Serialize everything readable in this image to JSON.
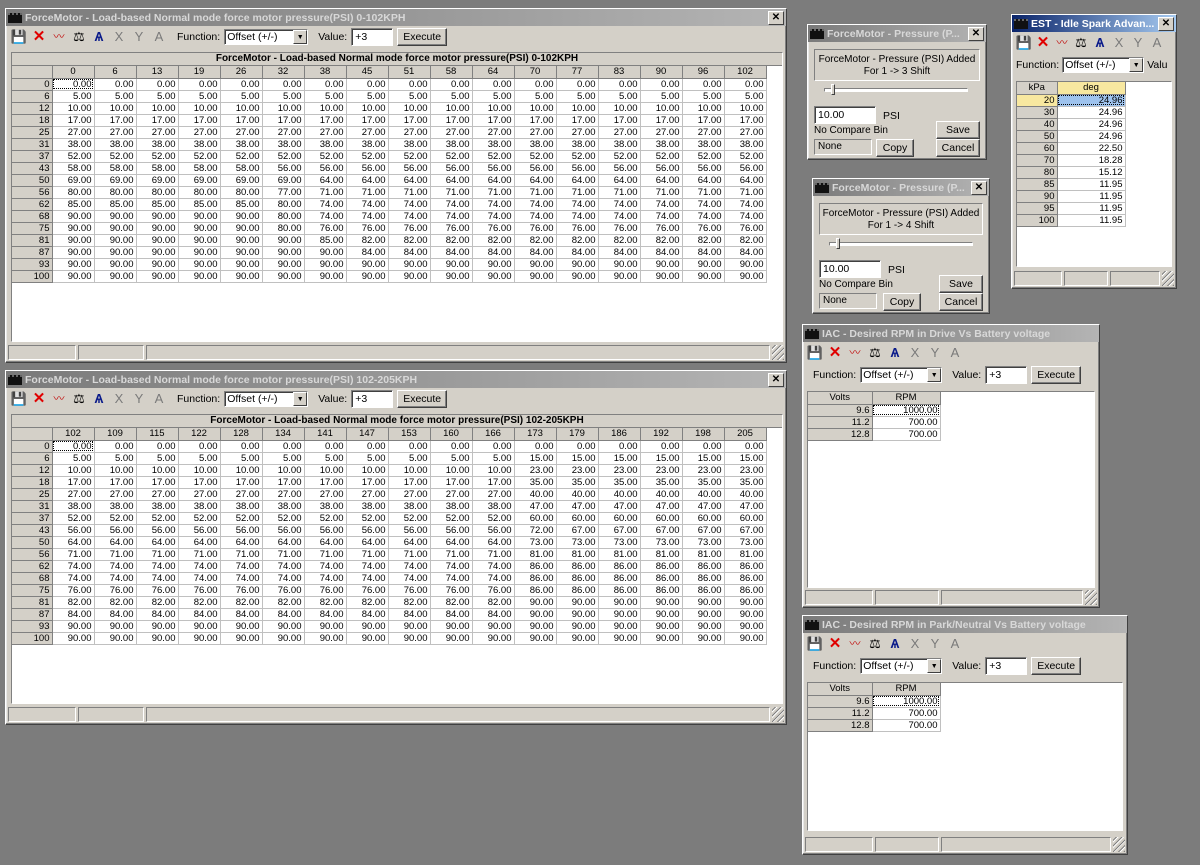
{
  "toolbar": {
    "function_label": "Function:",
    "function_value": "Offset (+/-)",
    "value_label": "Value:",
    "value_value": "+3",
    "execute_label": "Execute",
    "icons": [
      "save-icon",
      "delete-icon",
      "graph-icon",
      "scale-icon",
      "axis-icon",
      "x-axis-icon",
      "y-axis-icon",
      "font-icon"
    ]
  },
  "window1": {
    "title": "ForceMotor - Load-based Normal mode force motor pressure(PSI) 0-102KPH",
    "grid_title": "ForceMotor - Load-based Normal mode force motor pressure(PSI) 0-102KPH",
    "columns": [
      "0",
      "6",
      "13",
      "19",
      "26",
      "32",
      "38",
      "45",
      "51",
      "58",
      "64",
      "70",
      "77",
      "83",
      "90",
      "96",
      "102"
    ],
    "rows": [
      {
        "label": "0",
        "values": [
          "0.00",
          "0.00",
          "0.00",
          "0.00",
          "0.00",
          "0.00",
          "0.00",
          "0.00",
          "0.00",
          "0.00",
          "0.00",
          "0.00",
          "0.00",
          "0.00",
          "0.00",
          "0.00",
          "0.00"
        ]
      },
      {
        "label": "6",
        "values": [
          "5.00",
          "5.00",
          "5.00",
          "5.00",
          "5.00",
          "5.00",
          "5.00",
          "5.00",
          "5.00",
          "5.00",
          "5.00",
          "5.00",
          "5.00",
          "5.00",
          "5.00",
          "5.00",
          "5.00"
        ]
      },
      {
        "label": "12",
        "values": [
          "10.00",
          "10.00",
          "10.00",
          "10.00",
          "10.00",
          "10.00",
          "10.00",
          "10.00",
          "10.00",
          "10.00",
          "10.00",
          "10.00",
          "10.00",
          "10.00",
          "10.00",
          "10.00",
          "10.00"
        ]
      },
      {
        "label": "18",
        "values": [
          "17.00",
          "17.00",
          "17.00",
          "17.00",
          "17.00",
          "17.00",
          "17.00",
          "17.00",
          "17.00",
          "17.00",
          "17.00",
          "17.00",
          "17.00",
          "17.00",
          "17.00",
          "17.00",
          "17.00"
        ]
      },
      {
        "label": "25",
        "values": [
          "27.00",
          "27.00",
          "27.00",
          "27.00",
          "27.00",
          "27.00",
          "27.00",
          "27.00",
          "27.00",
          "27.00",
          "27.00",
          "27.00",
          "27.00",
          "27.00",
          "27.00",
          "27.00",
          "27.00"
        ]
      },
      {
        "label": "31",
        "values": [
          "38.00",
          "38.00",
          "38.00",
          "38.00",
          "38.00",
          "38.00",
          "38.00",
          "38.00",
          "38.00",
          "38.00",
          "38.00",
          "38.00",
          "38.00",
          "38.00",
          "38.00",
          "38.00",
          "38.00"
        ]
      },
      {
        "label": "37",
        "values": [
          "52.00",
          "52.00",
          "52.00",
          "52.00",
          "52.00",
          "52.00",
          "52.00",
          "52.00",
          "52.00",
          "52.00",
          "52.00",
          "52.00",
          "52.00",
          "52.00",
          "52.00",
          "52.00",
          "52.00"
        ]
      },
      {
        "label": "43",
        "values": [
          "58.00",
          "58.00",
          "58.00",
          "58.00",
          "58.00",
          "56.00",
          "56.00",
          "56.00",
          "56.00",
          "56.00",
          "56.00",
          "56.00",
          "56.00",
          "56.00",
          "56.00",
          "56.00",
          "56.00"
        ]
      },
      {
        "label": "50",
        "values": [
          "69.00",
          "69.00",
          "69.00",
          "69.00",
          "69.00",
          "69.00",
          "64.00",
          "64.00",
          "64.00",
          "64.00",
          "64.00",
          "64.00",
          "64.00",
          "64.00",
          "64.00",
          "64.00",
          "64.00"
        ]
      },
      {
        "label": "56",
        "values": [
          "80.00",
          "80.00",
          "80.00",
          "80.00",
          "80.00",
          "77.00",
          "71.00",
          "71.00",
          "71.00",
          "71.00",
          "71.00",
          "71.00",
          "71.00",
          "71.00",
          "71.00",
          "71.00",
          "71.00"
        ]
      },
      {
        "label": "62",
        "values": [
          "85.00",
          "85.00",
          "85.00",
          "85.00",
          "85.00",
          "80.00",
          "74.00",
          "74.00",
          "74.00",
          "74.00",
          "74.00",
          "74.00",
          "74.00",
          "74.00",
          "74.00",
          "74.00",
          "74.00"
        ]
      },
      {
        "label": "68",
        "values": [
          "90.00",
          "90.00",
          "90.00",
          "90.00",
          "90.00",
          "80.00",
          "74.00",
          "74.00",
          "74.00",
          "74.00",
          "74.00",
          "74.00",
          "74.00",
          "74.00",
          "74.00",
          "74.00",
          "74.00"
        ]
      },
      {
        "label": "75",
        "values": [
          "90.00",
          "90.00",
          "90.00",
          "90.00",
          "90.00",
          "80.00",
          "76.00",
          "76.00",
          "76.00",
          "76.00",
          "76.00",
          "76.00",
          "76.00",
          "76.00",
          "76.00",
          "76.00",
          "76.00"
        ]
      },
      {
        "label": "81",
        "values": [
          "90.00",
          "90.00",
          "90.00",
          "90.00",
          "90.00",
          "90.00",
          "85.00",
          "82.00",
          "82.00",
          "82.00",
          "82.00",
          "82.00",
          "82.00",
          "82.00",
          "82.00",
          "82.00",
          "82.00"
        ]
      },
      {
        "label": "87",
        "values": [
          "90.00",
          "90.00",
          "90.00",
          "90.00",
          "90.00",
          "90.00",
          "90.00",
          "84.00",
          "84.00",
          "84.00",
          "84.00",
          "84.00",
          "84.00",
          "84.00",
          "84.00",
          "84.00",
          "84.00"
        ]
      },
      {
        "label": "93",
        "values": [
          "90.00",
          "90.00",
          "90.00",
          "90.00",
          "90.00",
          "90.00",
          "90.00",
          "90.00",
          "90.00",
          "90.00",
          "90.00",
          "90.00",
          "90.00",
          "90.00",
          "90.00",
          "90.00",
          "90.00"
        ]
      },
      {
        "label": "100",
        "values": [
          "90.00",
          "90.00",
          "90.00",
          "90.00",
          "90.00",
          "90.00",
          "90.00",
          "90.00",
          "90.00",
          "90.00",
          "90.00",
          "90.00",
          "90.00",
          "90.00",
          "90.00",
          "90.00",
          "90.00"
        ]
      }
    ]
  },
  "window2": {
    "title": "ForceMotor - Load-based Normal mode force motor pressure(PSI) 102-205KPH",
    "grid_title": "ForceMotor - Load-based Normal mode force motor pressure(PSI) 102-205KPH",
    "columns": [
      "102",
      "109",
      "115",
      "122",
      "128",
      "134",
      "141",
      "147",
      "153",
      "160",
      "166",
      "173",
      "179",
      "186",
      "192",
      "198",
      "205"
    ],
    "rows": [
      {
        "label": "0",
        "values": [
          "0.00",
          "0.00",
          "0.00",
          "0.00",
          "0.00",
          "0.00",
          "0.00",
          "0.00",
          "0.00",
          "0.00",
          "0.00",
          "0.00",
          "0.00",
          "0.00",
          "0.00",
          "0.00",
          "0.00"
        ]
      },
      {
        "label": "6",
        "values": [
          "5.00",
          "5.00",
          "5.00",
          "5.00",
          "5.00",
          "5.00",
          "5.00",
          "5.00",
          "5.00",
          "5.00",
          "5.00",
          "15.00",
          "15.00",
          "15.00",
          "15.00",
          "15.00",
          "15.00"
        ]
      },
      {
        "label": "12",
        "values": [
          "10.00",
          "10.00",
          "10.00",
          "10.00",
          "10.00",
          "10.00",
          "10.00",
          "10.00",
          "10.00",
          "10.00",
          "10.00",
          "23.00",
          "23.00",
          "23.00",
          "23.00",
          "23.00",
          "23.00"
        ]
      },
      {
        "label": "18",
        "values": [
          "17.00",
          "17.00",
          "17.00",
          "17.00",
          "17.00",
          "17.00",
          "17.00",
          "17.00",
          "17.00",
          "17.00",
          "17.00",
          "35.00",
          "35.00",
          "35.00",
          "35.00",
          "35.00",
          "35.00"
        ]
      },
      {
        "label": "25",
        "values": [
          "27.00",
          "27.00",
          "27.00",
          "27.00",
          "27.00",
          "27.00",
          "27.00",
          "27.00",
          "27.00",
          "27.00",
          "27.00",
          "40.00",
          "40.00",
          "40.00",
          "40.00",
          "40.00",
          "40.00"
        ]
      },
      {
        "label": "31",
        "values": [
          "38.00",
          "38.00",
          "38.00",
          "38.00",
          "38.00",
          "38.00",
          "38.00",
          "38.00",
          "38.00",
          "38.00",
          "38.00",
          "47.00",
          "47.00",
          "47.00",
          "47.00",
          "47.00",
          "47.00"
        ]
      },
      {
        "label": "37",
        "values": [
          "52.00",
          "52.00",
          "52.00",
          "52.00",
          "52.00",
          "52.00",
          "52.00",
          "52.00",
          "52.00",
          "52.00",
          "52.00",
          "60.00",
          "60.00",
          "60.00",
          "60.00",
          "60.00",
          "60.00"
        ]
      },
      {
        "label": "43",
        "values": [
          "56.00",
          "56.00",
          "56.00",
          "56.00",
          "56.00",
          "56.00",
          "56.00",
          "56.00",
          "56.00",
          "56.00",
          "56.00",
          "72.00",
          "67.00",
          "67.00",
          "67.00",
          "67.00",
          "67.00"
        ]
      },
      {
        "label": "50",
        "values": [
          "64.00",
          "64.00",
          "64.00",
          "64.00",
          "64.00",
          "64.00",
          "64.00",
          "64.00",
          "64.00",
          "64.00",
          "64.00",
          "73.00",
          "73.00",
          "73.00",
          "73.00",
          "73.00",
          "73.00"
        ]
      },
      {
        "label": "56",
        "values": [
          "71.00",
          "71.00",
          "71.00",
          "71.00",
          "71.00",
          "71.00",
          "71.00",
          "71.00",
          "71.00",
          "71.00",
          "71.00",
          "81.00",
          "81.00",
          "81.00",
          "81.00",
          "81.00",
          "81.00"
        ]
      },
      {
        "label": "62",
        "values": [
          "74.00",
          "74.00",
          "74.00",
          "74.00",
          "74.00",
          "74.00",
          "74.00",
          "74.00",
          "74.00",
          "74.00",
          "74.00",
          "86.00",
          "86.00",
          "86.00",
          "86.00",
          "86.00",
          "86.00"
        ]
      },
      {
        "label": "68",
        "values": [
          "74.00",
          "74.00",
          "74.00",
          "74.00",
          "74.00",
          "74.00",
          "74.00",
          "74.00",
          "74.00",
          "74.00",
          "74.00",
          "86.00",
          "86.00",
          "86.00",
          "86.00",
          "86.00",
          "86.00"
        ]
      },
      {
        "label": "75",
        "values": [
          "76.00",
          "76.00",
          "76.00",
          "76.00",
          "76.00",
          "76.00",
          "76.00",
          "76.00",
          "76.00",
          "76.00",
          "76.00",
          "86.00",
          "86.00",
          "86.00",
          "86.00",
          "86.00",
          "86.00"
        ]
      },
      {
        "label": "81",
        "values": [
          "82.00",
          "82.00",
          "82.00",
          "82.00",
          "82.00",
          "82.00",
          "82.00",
          "82.00",
          "82.00",
          "82.00",
          "82.00",
          "90.00",
          "90.00",
          "90.00",
          "90.00",
          "90.00",
          "90.00"
        ]
      },
      {
        "label": "87",
        "values": [
          "84.00",
          "84.00",
          "84.00",
          "84.00",
          "84.00",
          "84.00",
          "84.00",
          "84.00",
          "84.00",
          "84.00",
          "84.00",
          "90.00",
          "90.00",
          "90.00",
          "90.00",
          "90.00",
          "90.00"
        ]
      },
      {
        "label": "93",
        "values": [
          "90.00",
          "90.00",
          "90.00",
          "90.00",
          "90.00",
          "90.00",
          "90.00",
          "90.00",
          "90.00",
          "90.00",
          "90.00",
          "90.00",
          "90.00",
          "90.00",
          "90.00",
          "90.00",
          "90.00"
        ]
      },
      {
        "label": "100",
        "values": [
          "90.00",
          "90.00",
          "90.00",
          "90.00",
          "90.00",
          "90.00",
          "90.00",
          "90.00",
          "90.00",
          "90.00",
          "90.00",
          "90.00",
          "90.00",
          "90.00",
          "90.00",
          "90.00",
          "90.00"
        ]
      }
    ]
  },
  "dialog1": {
    "title": "ForceMotor - Pressure (P...",
    "desc_line1": "ForceMotor - Pressure (PSI) Added",
    "desc_line2": "For 1 -> 3 Shift",
    "value": "10.00",
    "unit": "PSI",
    "compare_label": "No Compare Bin",
    "compare_value": "None",
    "copy_label": "Copy",
    "save_label": "Save",
    "cancel_label": "Cancel"
  },
  "dialog2": {
    "title": "ForceMotor - Pressure (P...",
    "desc_line1": "ForceMotor - Pressure (PSI) Added",
    "desc_line2": "For 1 -> 4 Shift",
    "value": "10.00",
    "unit": "PSI",
    "compare_label": "No Compare Bin",
    "compare_value": "None",
    "copy_label": "Copy",
    "save_label": "Save",
    "cancel_label": "Cancel"
  },
  "est": {
    "title": "EST - Idle Spark Advan...",
    "value_label_partial": "Valu",
    "col_headers": [
      "kPa",
      "deg"
    ],
    "rows": [
      [
        "20",
        "24.96"
      ],
      [
        "30",
        "24.96"
      ],
      [
        "40",
        "24.96"
      ],
      [
        "50",
        "24.96"
      ],
      [
        "60",
        "22.50"
      ],
      [
        "70",
        "18.28"
      ],
      [
        "80",
        "15.12"
      ],
      [
        "85",
        "11.95"
      ],
      [
        "90",
        "11.95"
      ],
      [
        "95",
        "11.95"
      ],
      [
        "100",
        "11.95"
      ]
    ]
  },
  "iac_drive": {
    "title": "IAC - Desired RPM in Drive Vs Battery voltage",
    "col_headers": [
      "Volts",
      "RPM"
    ],
    "rows": [
      [
        "9.6",
        "1000.00"
      ],
      [
        "11.2",
        "700.00"
      ],
      [
        "12.8",
        "700.00"
      ]
    ]
  },
  "iac_park": {
    "title": "IAC - Desired RPM in Park/Neutral Vs Battery voltage",
    "col_headers": [
      "Volts",
      "RPM"
    ],
    "rows": [
      [
        "9.6",
        "1000.00"
      ],
      [
        "11.2",
        "700.00"
      ],
      [
        "12.8",
        "700.00"
      ]
    ]
  }
}
